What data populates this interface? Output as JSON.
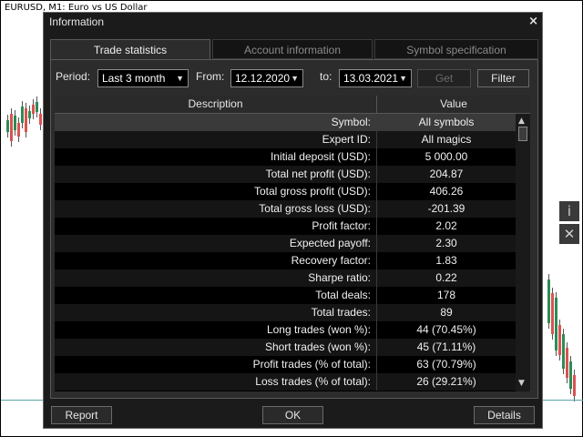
{
  "chart": {
    "title": "EURUSD, M1:  Euro vs US Dollar",
    "side_buttons": [
      "i",
      "✕"
    ]
  },
  "dialog": {
    "title": "Information",
    "close_glyph": "×",
    "tabs": [
      {
        "label": "Trade statistics",
        "active": true
      },
      {
        "label": "Account information",
        "active": false
      },
      {
        "label": "Symbol specification",
        "active": false
      }
    ],
    "filters": {
      "period_label": "Period:",
      "period_value": "Last 3 month",
      "from_label": "From:",
      "from_value": "12.12.2020",
      "to_label": "to:",
      "to_value": "13.03.2021",
      "get_label": "Get",
      "filter_label": "Filter"
    },
    "table": {
      "columns": [
        "Description",
        "Value"
      ],
      "rows": [
        {
          "desc": "Symbol:",
          "value": "All symbols"
        },
        {
          "desc": "Expert ID:",
          "value": "All magics"
        },
        {
          "desc": "Initial deposit (USD):",
          "value": "5 000.00"
        },
        {
          "desc": "Total net profit (USD):",
          "value": "204.87"
        },
        {
          "desc": "Total gross profit (USD):",
          "value": "406.26"
        },
        {
          "desc": "Total gross loss (USD):",
          "value": "-201.39"
        },
        {
          "desc": "Profit factor:",
          "value": "2.02"
        },
        {
          "desc": "Expected payoff:",
          "value": "2.30"
        },
        {
          "desc": "Recovery factor:",
          "value": "1.83"
        },
        {
          "desc": "Sharpe ratio:",
          "value": "0.22"
        },
        {
          "desc": "Total deals:",
          "value": "178"
        },
        {
          "desc": "Total trades:",
          "value": "89"
        },
        {
          "desc": "Long trades (won %):",
          "value": "44 (70.45%)"
        },
        {
          "desc": "Short trades (won %):",
          "value": "45 (71.11%)"
        },
        {
          "desc": "Profit trades (% of total):",
          "value": "63 (70.79%)"
        },
        {
          "desc": "Loss trades (% of total):",
          "value": "26 (29.21%)"
        }
      ]
    },
    "footer": {
      "report_label": "Report",
      "ok_label": "OK",
      "details_label": "Details"
    }
  },
  "colors": {
    "dialog_bg": "#1b1b1b",
    "panel_bg": "#2c2c2c",
    "bull_candle": "#2e8b57",
    "bear_candle": "#d9534f"
  }
}
